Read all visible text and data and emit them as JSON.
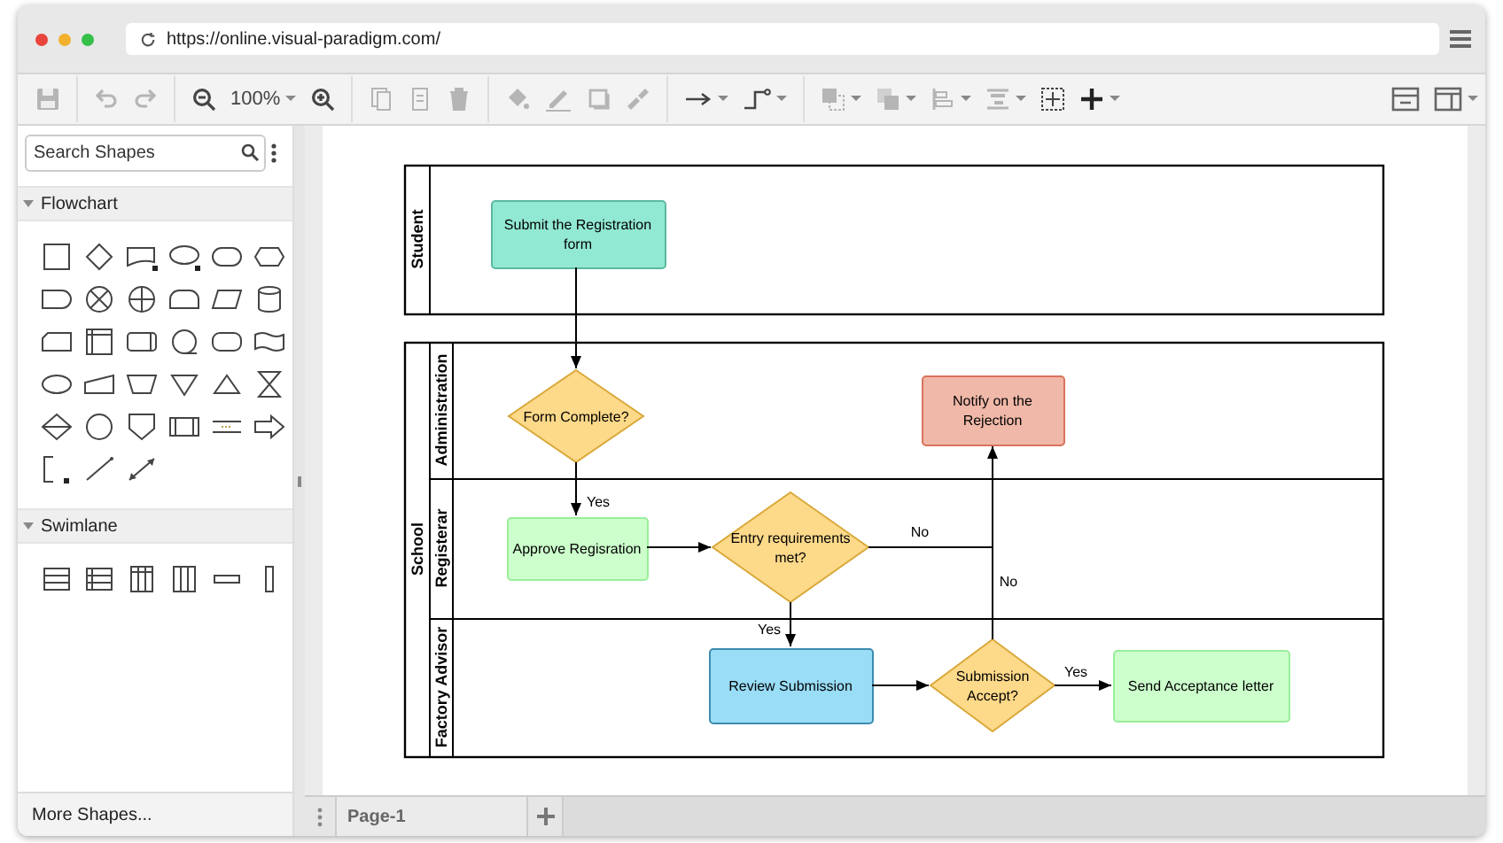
{
  "browser": {
    "url": "https://online.visual-paradigm.com/"
  },
  "toolbar": {
    "zoom": "100%"
  },
  "sidebar": {
    "search": {
      "placeholder": "Search Shapes"
    },
    "sections": [
      {
        "title": "Flowchart",
        "kind": "flowchart",
        "expanded": true
      },
      {
        "title": "Swimlane",
        "kind": "swimlane",
        "expanded": true
      }
    ],
    "more_shapes": "More Shapes..."
  },
  "diagram": {
    "pools": [
      {
        "label": "Student",
        "lanes": [
          {
            "nodes": [
              {
                "kind": "process",
                "text": "Submit the Registration form",
                "color": "#92e9d3"
              }
            ]
          }
        ]
      },
      {
        "label": "School",
        "lanes": [
          {
            "label": "Administration",
            "nodes": [
              {
                "kind": "decision",
                "text": "Form Complete?",
                "color": "#fdd98a"
              },
              {
                "kind": "process",
                "text": "Notify on the Rejection",
                "color": "#f0b8a8"
              }
            ]
          },
          {
            "label": "Registerar",
            "nodes": [
              {
                "kind": "process",
                "text": "Approve Regisration",
                "color": "#ccffcc"
              },
              {
                "kind": "decision",
                "text": "Entry requirements met?",
                "color": "#fdd98a"
              }
            ]
          },
          {
            "label": "Factory Advisor",
            "nodes": [
              {
                "kind": "process",
                "text": "Review Submission",
                "color": "#99ddf7"
              },
              {
                "kind": "decision",
                "text": "Submission Accept?",
                "color": "#fdd98a"
              },
              {
                "kind": "process",
                "text": "Send Acceptance letter",
                "color": "#ccffcc"
              }
            ]
          }
        ]
      }
    ],
    "edges": [
      {
        "kind": "arrow"
      },
      {
        "kind": "arrow",
        "label": "Yes"
      },
      {
        "kind": "arrow"
      },
      {
        "kind": "arrow",
        "label": "No"
      },
      {
        "kind": "arrow",
        "label": "Yes"
      },
      {
        "kind": "arrow"
      },
      {
        "kind": "line",
        "label": "No"
      },
      {
        "kind": "arrow",
        "label": "Yes"
      }
    ]
  },
  "pages": [
    {
      "label": "Page-1",
      "selected": true
    }
  ]
}
